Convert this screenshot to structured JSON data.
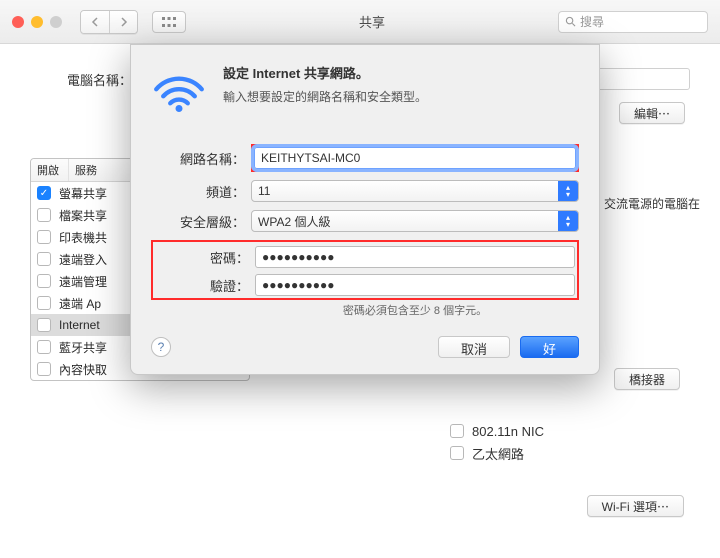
{
  "titlebar": {
    "title": "共享",
    "search_placeholder": "搜尋"
  },
  "name_row": {
    "label": "電腦名稱："
  },
  "buttons": {
    "edit": "編輯⋯",
    "wifi_options": "Wi-Fi 選項⋯",
    "bridge": "橋接器"
  },
  "table": {
    "headers": [
      "開啟",
      "服務"
    ],
    "rows": [
      {
        "on": true,
        "label": "螢幕共享"
      },
      {
        "on": false,
        "label": "檔案共享"
      },
      {
        "on": false,
        "label": "印表機共"
      },
      {
        "on": false,
        "label": "遠端登入"
      },
      {
        "on": false,
        "label": "遠端管理"
      },
      {
        "on": false,
        "label": "遠端 Ap"
      },
      {
        "on": false,
        "label": "Internet",
        "selected": true
      },
      {
        "on": false,
        "label": "藍牙共享"
      },
      {
        "on": false,
        "label": "內容快取"
      }
    ]
  },
  "side_text": "交流電源的電腦在",
  "extra_items": [
    "802.11n NIC",
    "乙太網路"
  ],
  "sheet": {
    "title": "設定 Internet 共享網路。",
    "subtitle": "輸入想要設定的網路名稱和安全類型。",
    "labels": {
      "name": "網路名稱：",
      "channel": "頻道：",
      "security": "安全層級：",
      "password": "密碼：",
      "verify": "驗證："
    },
    "values": {
      "name": "KEITHYTSAI-MC0",
      "channel": "11",
      "security": "WPA2 個人級",
      "password": "●●●●●●●●●●",
      "verify": "●●●●●●●●●●"
    },
    "hint": "密碼必須包含至少 8 個字元。",
    "cancel": "取消",
    "ok": "好"
  }
}
